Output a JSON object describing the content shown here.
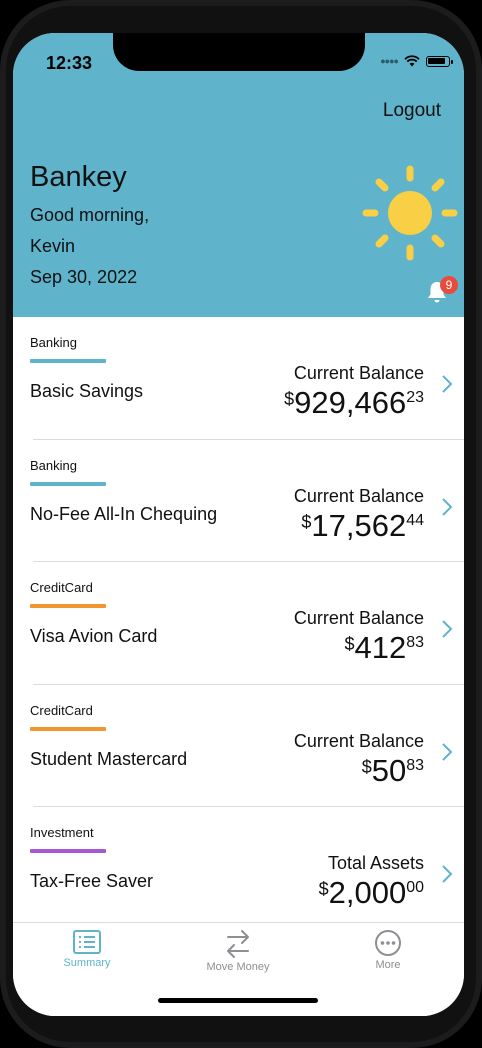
{
  "status": {
    "time": "12:33"
  },
  "header": {
    "logout_label": "Logout",
    "app_title": "Bankey",
    "greeting": "Good morning,",
    "user_name": "Kevin",
    "date": "Sep 30, 2022",
    "notification_count": "9",
    "weather_icon": "sun-icon",
    "colors": {
      "header_bg": "#5fb3cb",
      "sun": "#f9cf46",
      "badge": "#e74c3c"
    }
  },
  "accounts": [
    {
      "category": "Banking",
      "category_color": "#5fb3cb",
      "name": "Basic Savings",
      "balance_label": "Current Balance",
      "currency": "$",
      "whole": "929,466",
      "cents": "23"
    },
    {
      "category": "Banking",
      "category_color": "#5fb3cb",
      "name": "No-Fee All-In Chequing",
      "balance_label": "Current Balance",
      "currency": "$",
      "whole": "17,562",
      "cents": "44"
    },
    {
      "category": "CreditCard",
      "category_color": "#f0952f",
      "name": "Visa Avion Card",
      "balance_label": "Current Balance",
      "currency": "$",
      "whole": "412",
      "cents": "83"
    },
    {
      "category": "CreditCard",
      "category_color": "#f0952f",
      "name": "Student Mastercard",
      "balance_label": "Current Balance",
      "currency": "$",
      "whole": "50",
      "cents": "83"
    },
    {
      "category": "Investment",
      "category_color": "#a55ad3",
      "name": "Tax-Free Saver",
      "balance_label": "Total Assets",
      "currency": "$",
      "whole": "2,000",
      "cents": "00"
    }
  ],
  "tabbar": {
    "tabs": [
      {
        "label": "Summary",
        "icon": "list-icon",
        "selected": true
      },
      {
        "label": "Move Money",
        "icon": "arrows-swap-icon",
        "selected": false
      },
      {
        "label": "More",
        "icon": "more-icon",
        "selected": false
      }
    ],
    "colors": {
      "active": "#5fb3cb",
      "inactive": "#8e8e93"
    }
  }
}
